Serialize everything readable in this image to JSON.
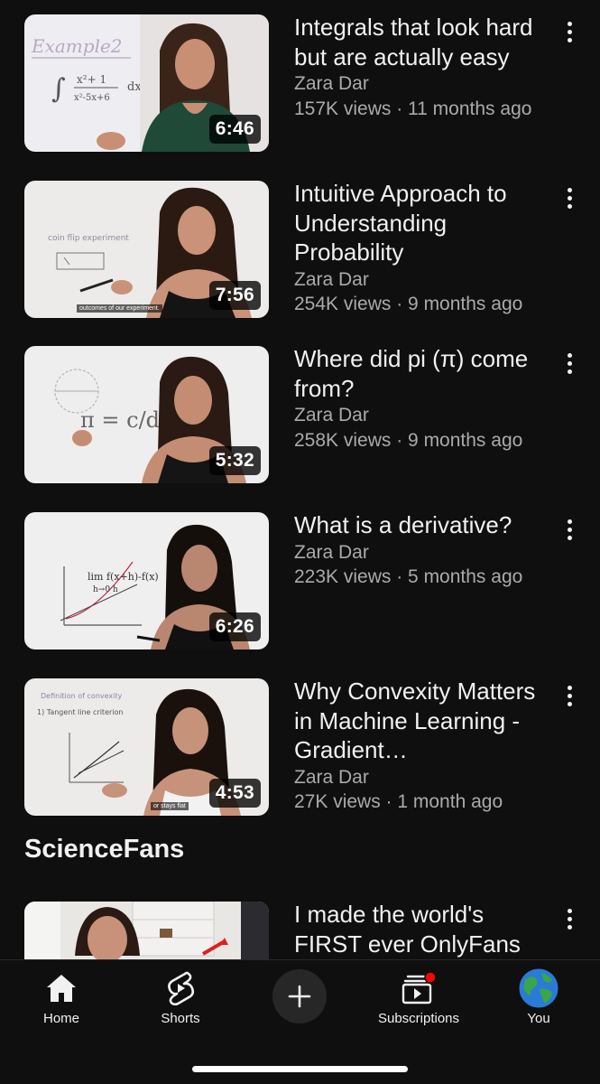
{
  "videos": [
    {
      "title": "Integrals that look hard but are actually easy",
      "channel": "Zara Dar",
      "stats": "157K views · 11 months ago",
      "duration": "6:46",
      "caption": ""
    },
    {
      "title": "Intuitive Approach to Understanding Probability",
      "channel": "Zara Dar",
      "stats": "254K views · 9 months ago",
      "duration": "7:56",
      "caption": "outcomes of our experiment."
    },
    {
      "title": "Where did pi (π) come from?",
      "channel": "Zara Dar",
      "stats": "258K views · 9 months ago",
      "duration": "5:32",
      "caption": ""
    },
    {
      "title": "What is a derivative?",
      "channel": "Zara Dar",
      "stats": "223K views · 5 months ago",
      "duration": "6:26",
      "caption": ""
    },
    {
      "title": "Why Convexity Matters in Machine Learning - Gradient…",
      "channel": "Zara Dar",
      "stats": "27K views · 1 month ago",
      "duration": "4:53",
      "caption": "or stays flat"
    }
  ],
  "section": {
    "title": "ScienceFans",
    "video": {
      "title": "I made the world's FIRST ever OnlyFans"
    }
  },
  "nav": {
    "home": "Home",
    "shorts": "Shorts",
    "subscriptions": "Subscriptions",
    "you": "You"
  },
  "colors": {
    "background": "#0f0f0f",
    "text_primary": "#f1f1f1",
    "text_secondary": "#aaaaaa",
    "notification_dot": "#ff0000"
  },
  "icons": [
    "home-icon",
    "shorts-icon",
    "create-icon",
    "subscriptions-icon",
    "avatar-globe-icon",
    "more-vert-icon"
  ]
}
